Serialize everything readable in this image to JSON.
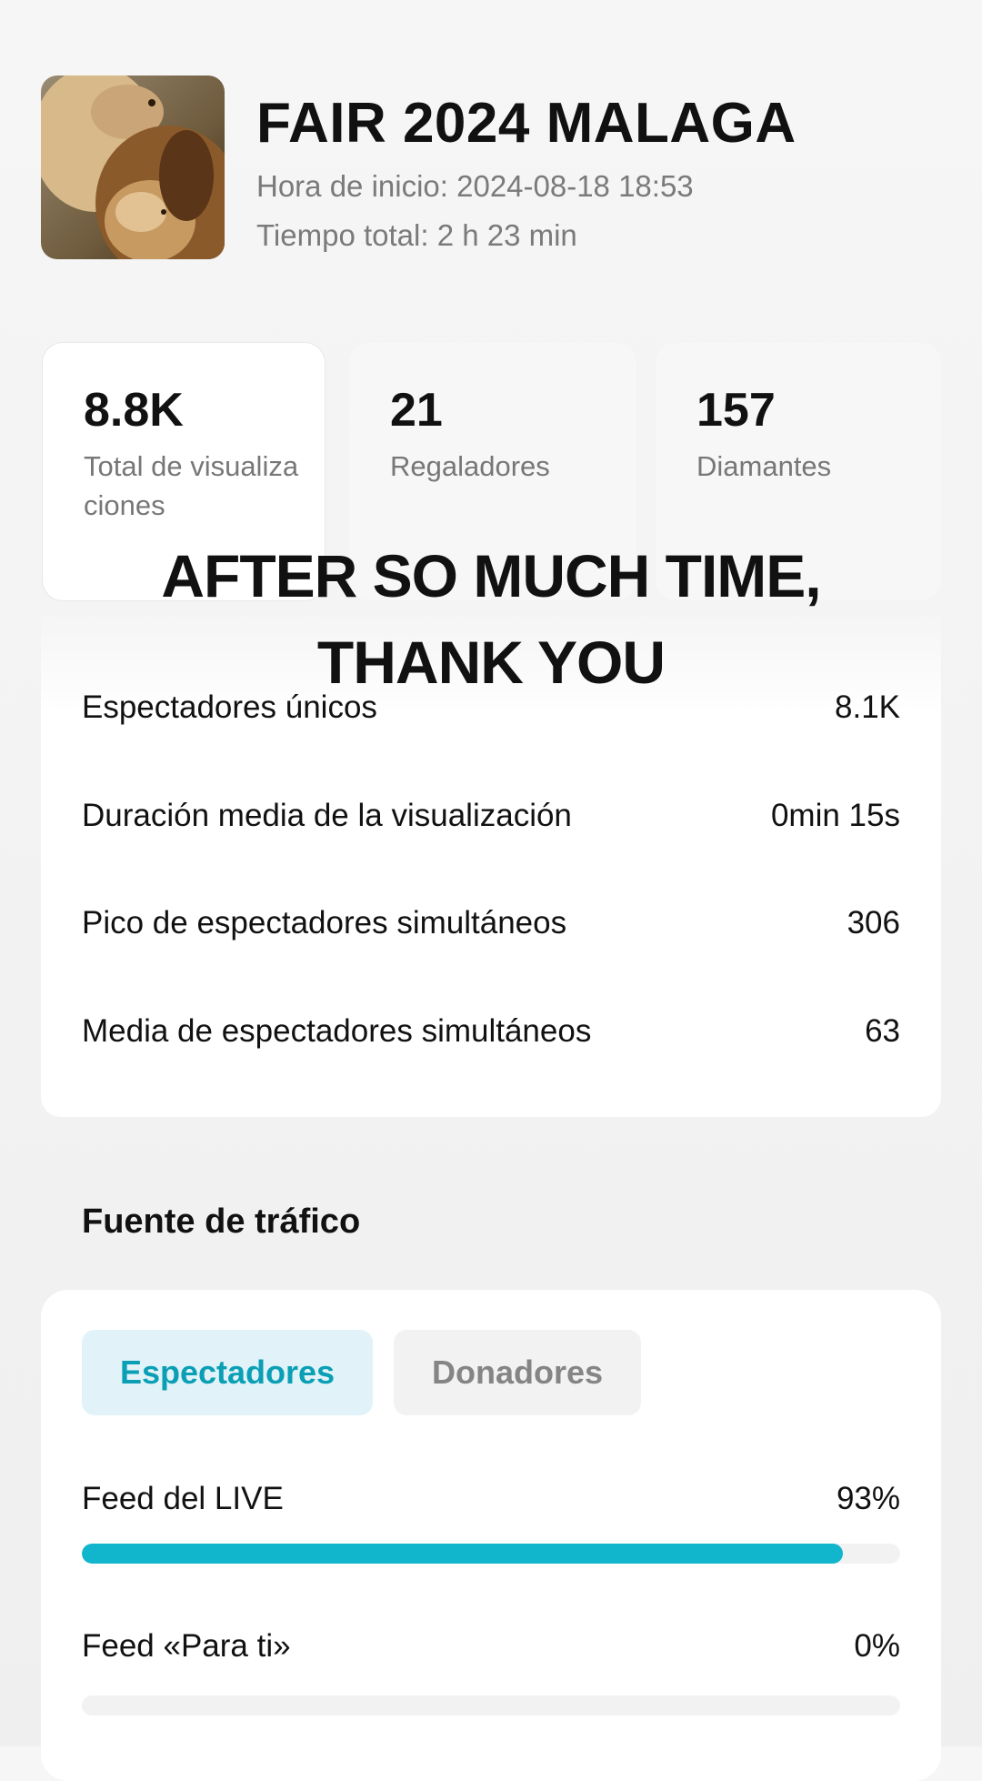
{
  "stream": {
    "title": "FAIR 2024 MALAGA",
    "start_label": "Hora de inicio: 2024-08-18 18:53",
    "total_label": "Tiempo total: 2 h 23 min",
    "thumbnail": "lion-couple-photo"
  },
  "stats": [
    {
      "value": "8.8K",
      "label": "Total de visualizaciones"
    },
    {
      "value": "21",
      "label": "Regaladores"
    },
    {
      "value": "157",
      "label": "Diamantes"
    }
  ],
  "overlay_text": [
    "AFTER SO MUCH TIME,",
    "THANK YOU"
  ],
  "metrics": [
    {
      "label": "Espectadores únicos",
      "value": "8.1K"
    },
    {
      "label": "Duración media de la visualización",
      "value": "0min 15s"
    },
    {
      "label": "Pico de espectadores simultáneos",
      "value": "306"
    },
    {
      "label": "Media de espectadores simultáneos",
      "value": "63"
    }
  ],
  "traffic": {
    "section_title": "Fuente de tráfico",
    "tabs": [
      "Espectadores",
      "Donadores"
    ],
    "active_tab": "Espectadores",
    "sources": [
      {
        "label": "Feed del LIVE",
        "percent_label": "93%",
        "fraction": 0.93
      },
      {
        "label": "Feed «Para ti»",
        "percent_label": "0%",
        "fraction": 0
      }
    ]
  },
  "colors": {
    "accent": "#12b6cc",
    "active_tab_bg": "#e1f3f8",
    "active_tab_text": "#0a9fb5"
  }
}
